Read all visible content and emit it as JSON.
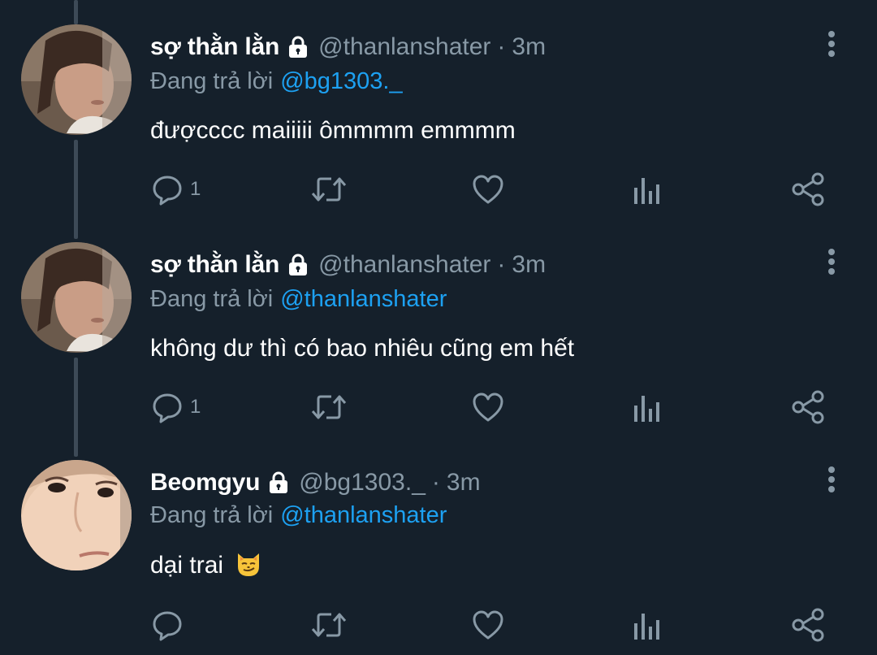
{
  "colors": {
    "background": "#15202b",
    "secondary_text": "#8899a6",
    "mention": "#1da1f2",
    "primary_text": "#ffffff",
    "thread_line": "#3d4a57"
  },
  "tweets": [
    {
      "display_name": "sợ thằn lằn",
      "handle": "@thanlanshater",
      "separator": "·",
      "time": "3m",
      "replying_label": "Đang trả lời",
      "replying_to": "@bg1303._",
      "text": "đượcccc maiiiii ômmmm emmmm",
      "reply_count": "1",
      "icons": [
        "lock-icon",
        "more-vertical-icon",
        "reply-icon",
        "retweet-icon",
        "like-icon",
        "analytics-icon",
        "share-icon"
      ]
    },
    {
      "display_name": "sợ thằn lằn",
      "handle": "@thanlanshater",
      "separator": "·",
      "time": "3m",
      "replying_label": "Đang trả lời",
      "replying_to": "@thanlanshater",
      "text": "không dư thì có bao nhiêu cũng em hết",
      "reply_count": "1",
      "icons": [
        "lock-icon",
        "more-vertical-icon",
        "reply-icon",
        "retweet-icon",
        "like-icon",
        "analytics-icon",
        "share-icon"
      ]
    },
    {
      "display_name": "Beomgyu",
      "handle": "@bg1303._",
      "separator": "·",
      "time": "3m",
      "replying_label": "Đang trả lời",
      "replying_to": "@thanlanshater",
      "text": "dại trai",
      "emoji": "smirking-cat-emoji",
      "reply_count": "",
      "icons": [
        "lock-icon",
        "more-vertical-icon",
        "reply-icon",
        "retweet-icon",
        "like-icon",
        "analytics-icon",
        "share-icon"
      ]
    }
  ]
}
